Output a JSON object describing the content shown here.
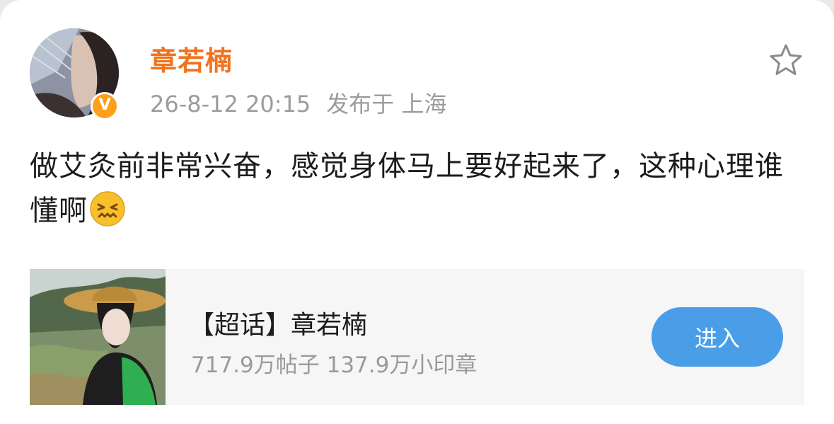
{
  "post": {
    "username": "章若楠",
    "date": "26-8-12 20:15",
    "source": "发布于 上海",
    "text": "做艾灸前非常兴奋，感觉身体马上要好起来了，这种心理谁懂啊",
    "emoji": "grimacing-face-emoji",
    "avatar_icon": "user-avatar",
    "verified_icon": "verified-badge-icon",
    "favorite_icon": "star-icon"
  },
  "topic": {
    "title": "【超话】章若楠",
    "stats": "717.9万帖子 137.9万小印章",
    "enter_label": "进入"
  },
  "colors": {
    "username": "#f0731f",
    "badge": "#ff9f1a",
    "button": "#4a9ee8",
    "meta_text": "#9c9c9c",
    "card_bg": "#f6f6f6"
  }
}
